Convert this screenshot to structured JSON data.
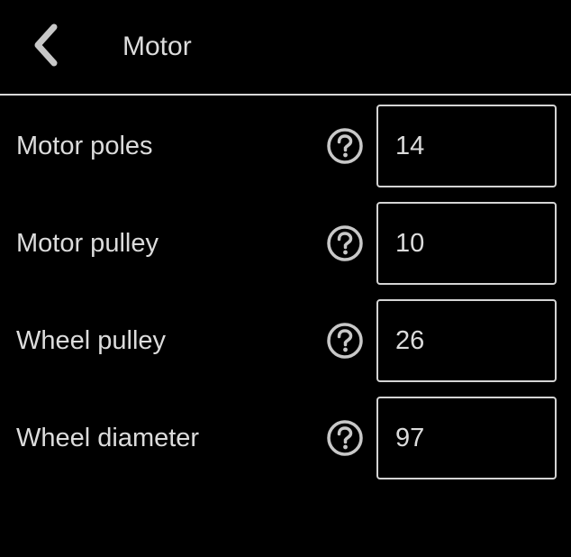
{
  "header": {
    "back_icon": "chevron-left-icon",
    "title": "Motor"
  },
  "settings": [
    {
      "label": "Motor poles",
      "value": "14",
      "help_icon": "question-circle-icon"
    },
    {
      "label": "Motor pulley",
      "value": "10",
      "help_icon": "question-circle-icon"
    },
    {
      "label": "Wheel pulley",
      "value": "26",
      "help_icon": "question-circle-icon"
    },
    {
      "label": "Wheel diameter",
      "value": "97",
      "help_icon": "question-circle-icon"
    }
  ],
  "colors": {
    "background": "#000000",
    "text": "#dcdcdc",
    "border": "#d4d4d4",
    "icon": "#c8c8c8"
  }
}
